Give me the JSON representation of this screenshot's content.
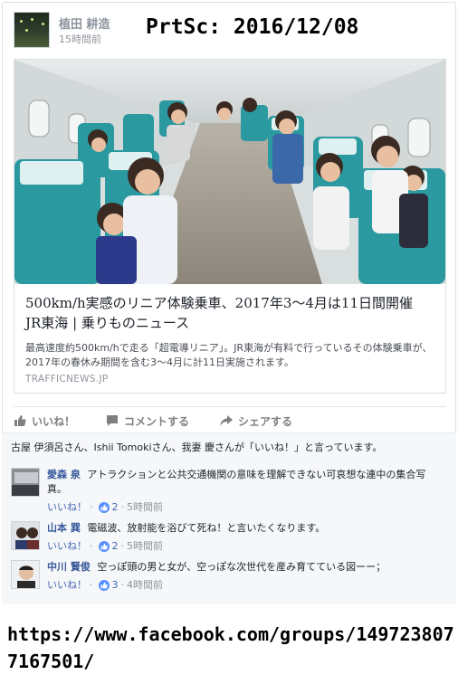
{
  "post": {
    "author": "植田 耕造",
    "time": "15時間前",
    "screenshot_stamp": "PrtSc: 2016/12/08"
  },
  "link": {
    "title": "500km/h実感のリニア体験乗車、2017年3〜4月は11日間開催　JR東海 | 乗りものニュース",
    "description": "最高速度約500km/hで走る「超電導リニア」。JR東海が有料で行っているその体験乗車が、2017年の春休み期間を含む3〜4月に計11日実施されます。",
    "domain": "TRAFFICNEWS.JP",
    "image_icon": "train-interior-photo"
  },
  "actions": {
    "like": "いいね！",
    "comment": "コメントする",
    "share": "シェアする"
  },
  "likers_text": "古屋 伊須呂さん、Ishii Tomokiさん、我妻 慶さんが「いいね！」と言っています。",
  "comments": [
    {
      "name": "愛森 泉",
      "text": "アトラクションと公共交通機関の意味を理解できない可哀想な連中の集合写真。",
      "like_label": "いいね！",
      "sep1": "·",
      "likes": "2",
      "sep2": "·",
      "time": "5時間前"
    },
    {
      "name": "山本 巽",
      "text": "電磁波、放射能を浴びて死ね！と言いたくなります。",
      "like_label": "いいね！",
      "sep1": "·",
      "likes": "2",
      "sep2": "·",
      "time": "5時間前"
    },
    {
      "name": "中川 賢俊",
      "text": "空っぽ頭の男と女が、空っぽな次世代を産み育てている図ーー；",
      "like_label": "いいね！",
      "sep1": "·",
      "likes": "3",
      "sep2": "·",
      "time": "4時間前"
    }
  ],
  "source_url": "https://www.facebook.com/groups/1497238077167501/",
  "colors": {
    "link_blue": "#365899",
    "like_blue": "#4267b2",
    "badge_blue": "#5890ff",
    "seat_teal": "#2b9aa0"
  }
}
